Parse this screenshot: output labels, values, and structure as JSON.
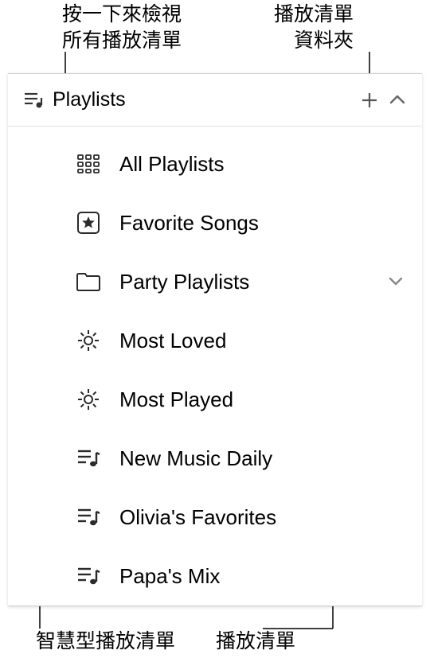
{
  "annotations": {
    "top_left_line1": "按一下來檢視",
    "top_left_line2": "所有播放清單",
    "top_right_line1": "播放清單",
    "top_right_line2": "資料夾",
    "bottom_left": "智慧型播放清單",
    "bottom_right": "播放清單"
  },
  "header": {
    "title": "Playlists"
  },
  "items": [
    {
      "label": "All Playlists",
      "icon": "grid"
    },
    {
      "label": "Favorite Songs",
      "icon": "star-box"
    },
    {
      "label": "Party Playlists",
      "icon": "folder",
      "has_chevron": true
    },
    {
      "label": "Most Loved",
      "icon": "gear"
    },
    {
      "label": "Most Played",
      "icon": "gear"
    },
    {
      "label": "New Music Daily",
      "icon": "music-list"
    },
    {
      "label": "Olivia's Favorites",
      "icon": "music-list"
    },
    {
      "label": "Papa's Mix",
      "icon": "music-list"
    }
  ]
}
